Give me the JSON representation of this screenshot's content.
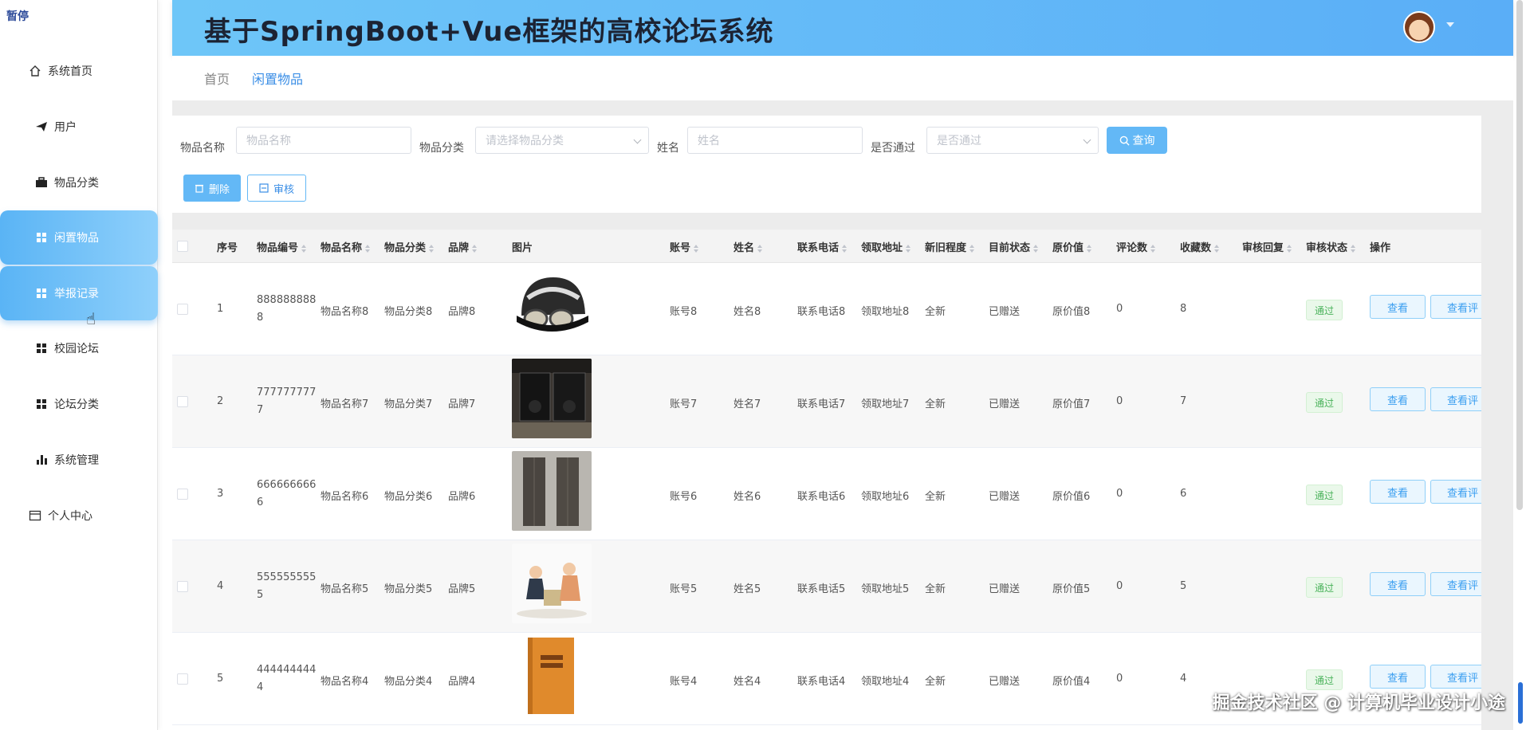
{
  "corner_tag": "暂停",
  "header": {
    "title": "基于SpringBoot+Vue框架的高校论坛系统"
  },
  "sidebar": {
    "items": [
      {
        "label": "系统首页",
        "icon": "home-icon"
      },
      {
        "label": "用户",
        "icon": "send-icon"
      },
      {
        "label": "物品分类",
        "icon": "briefcase-icon"
      },
      {
        "label": "闲置物品",
        "icon": "grid-icon"
      },
      {
        "label": "举报记录",
        "icon": "grid-icon"
      },
      {
        "label": "校园论坛",
        "icon": "grid-icon"
      },
      {
        "label": "论坛分类",
        "icon": "grid-icon"
      },
      {
        "label": "系统管理",
        "icon": "bar-chart-icon"
      },
      {
        "label": "个人中心",
        "icon": "id-card-icon"
      }
    ]
  },
  "breadcrumb": {
    "home": "首页",
    "current": "闲置物品"
  },
  "search": {
    "name_label": "物品名称",
    "name_placeholder": "物品名称",
    "category_label": "物品分类",
    "category_placeholder": "请选择物品分类",
    "person_label": "姓名",
    "person_placeholder": "姓名",
    "passed_label": "是否通过",
    "passed_placeholder": "是否通过",
    "query_button": "查询",
    "delete_button": "删除",
    "audit_button": "审核"
  },
  "table": {
    "headers": {
      "index": "序号",
      "code": "物品编号",
      "name": "物品名称",
      "category": "物品分类",
      "brand": "品牌",
      "image": "图片",
      "account": "账号",
      "person": "姓名",
      "phone": "联系电话",
      "address": "领取地址",
      "condition": "新旧程度",
      "status": "目前状态",
      "orig_price": "原价值",
      "comments": "评论数",
      "favorites": "收藏数",
      "reply": "审核回复",
      "audit": "审核状态",
      "ops": "操作"
    },
    "rows": [
      {
        "index": "1",
        "code": "8888888888",
        "name": "物品名称8",
        "category": "物品分类8",
        "brand": "品牌8",
        "image": "helmet",
        "account": "账号8",
        "person": "姓名8",
        "phone": "联系电话8",
        "address": "领取地址8",
        "condition": "全新",
        "status": "已赠送",
        "orig_price": "原价值8",
        "comments": "0",
        "favorites": "8",
        "audit": "通过",
        "view": "查看",
        "view_comment": "查看评"
      },
      {
        "index": "2",
        "code": "7777777777",
        "name": "物品名称7",
        "category": "物品分类7",
        "brand": "品牌7",
        "image": "speaker-box",
        "account": "账号7",
        "person": "姓名7",
        "phone": "联系电话7",
        "address": "领取地址7",
        "condition": "全新",
        "status": "已赠送",
        "orig_price": "原价值7",
        "comments": "0",
        "favorites": "7",
        "audit": "通过",
        "view": "查看",
        "view_comment": "查看评"
      },
      {
        "index": "3",
        "code": "6666666666",
        "name": "物品名称6",
        "category": "物品分类6",
        "brand": "品牌6",
        "image": "tower-speakers",
        "account": "账号6",
        "person": "姓名6",
        "phone": "联系电话6",
        "address": "领取地址6",
        "condition": "全新",
        "status": "已赠送",
        "orig_price": "原价值6",
        "comments": "0",
        "favorites": "6",
        "audit": "通过",
        "view": "查看",
        "view_comment": "查看评"
      },
      {
        "index": "4",
        "code": "5555555555",
        "name": "物品名称5",
        "category": "物品分类5",
        "brand": "品牌5",
        "image": "kids-illustration",
        "account": "账号5",
        "person": "姓名5",
        "phone": "联系电话5",
        "address": "领取地址5",
        "condition": "全新",
        "status": "已赠送",
        "orig_price": "原价值5",
        "comments": "0",
        "favorites": "5",
        "audit": "通过",
        "view": "查看",
        "view_comment": "查看评"
      },
      {
        "index": "5",
        "code": "4444444444",
        "name": "物品名称4",
        "category": "物品分类4",
        "brand": "品牌4",
        "image": "orange-book",
        "account": "账号4",
        "person": "姓名4",
        "phone": "联系电话4",
        "address": "领取地址4",
        "condition": "全新",
        "status": "已赠送",
        "orig_price": "原价值4",
        "comments": "0",
        "favorites": "4",
        "audit": "通过",
        "view": "查看",
        "view_comment": "查看评"
      }
    ]
  },
  "watermark": "掘金技术社区 @ 计算机毕业设计小途",
  "colors": {
    "accent": "#5ab4f5",
    "header_start": "#6ec6f8",
    "pass_tag": "#49b25a"
  }
}
